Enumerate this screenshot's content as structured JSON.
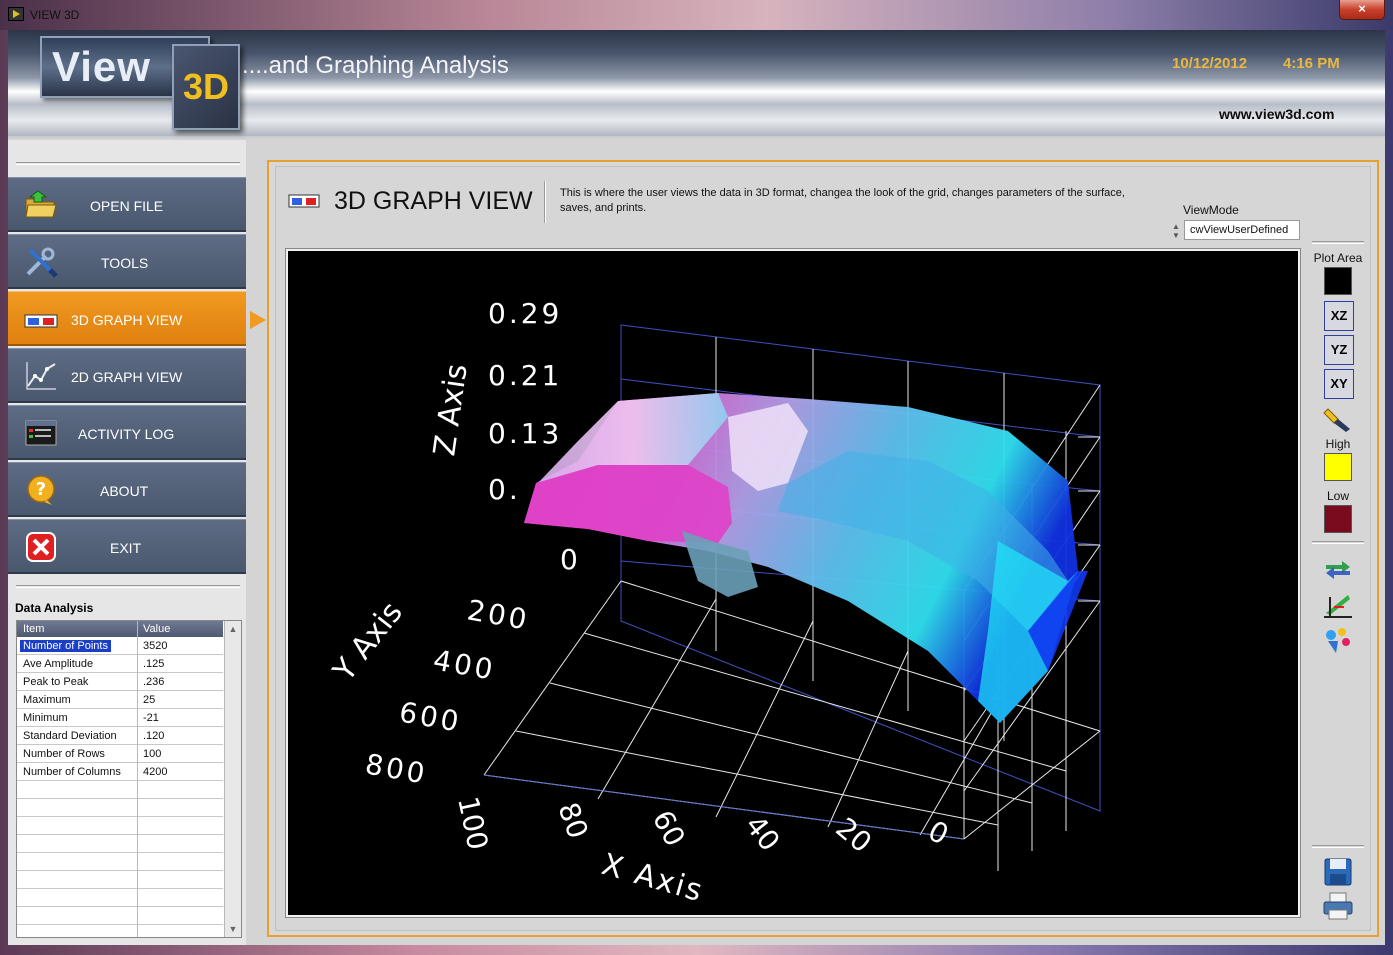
{
  "window": {
    "title": "VIEW 3D",
    "close_label": "×"
  },
  "header": {
    "logo_view": "View",
    "logo_3d": "3D",
    "tagline": "....and Graphing Analysis",
    "date": "10/12/2012",
    "time": "4:16 PM",
    "url": "www.view3d.com"
  },
  "sidebar": {
    "items": [
      {
        "label": "OPEN FILE",
        "icon": "folder-icon"
      },
      {
        "label": "TOOLS",
        "icon": "wrench-screwdriver-icon"
      },
      {
        "label": "3D GRAPH VIEW",
        "icon": "3d-glasses-icon",
        "active": true
      },
      {
        "label": "2D GRAPH VIEW",
        "icon": "line-graph-icon"
      },
      {
        "label": "ACTIVITY LOG",
        "icon": "log-window-icon"
      },
      {
        "label": "ABOUT",
        "icon": "question-icon"
      },
      {
        "label": "EXIT",
        "icon": "exit-x-icon"
      }
    ],
    "active_color": "#f09a20"
  },
  "data_analysis": {
    "title": "Data Analysis",
    "columns": [
      "Item",
      "Value"
    ],
    "rows": [
      {
        "item": "Number of Points",
        "value": "3520"
      },
      {
        "item": "Ave Amplitude",
        "value": ".125"
      },
      {
        "item": "Peak to Peak",
        "value": ".236"
      },
      {
        "item": "Maximum",
        "value": "25"
      },
      {
        "item": "Minimum",
        "value": "-21"
      },
      {
        "item": "Standard Deviation",
        "value": ".120"
      },
      {
        "item": "Number of Rows",
        "value": "100"
      },
      {
        "item": "Number of Columns",
        "value": "4200"
      }
    ],
    "selected_row": 0
  },
  "main": {
    "title": "3D GRAPH VIEW",
    "description": "This is where the user views the data in 3D format, changea the look of the grid, changes parameters of the surface, saves, and prints.",
    "viewmode_label": "ViewMode",
    "viewmode_value": "cwViewUserDefined"
  },
  "plot_3d": {
    "z_axis_label": "Z Axis",
    "y_axis_label": "Y Axis",
    "x_axis_label": "X Axis",
    "z_ticks": [
      "0.29",
      "0.21",
      "0.13",
      "0.",
      "0"
    ],
    "y_ticks": [
      "200",
      "400",
      "600",
      "800"
    ],
    "x_ticks": [
      "100",
      "80",
      "60",
      "40",
      "20",
      "0"
    ],
    "background": "#000000",
    "surface_colors": [
      "#e040c0",
      "#c8a0e8",
      "#40e0f0",
      "#1030e0"
    ]
  },
  "side_tools": {
    "plot_area_label": "Plot Area",
    "plot_area_color": "#000000",
    "planes": [
      "XZ",
      "YZ",
      "XY"
    ],
    "high_label": "High",
    "high_color": "#ffff00",
    "low_label": "Low",
    "low_color": "#7a0a1e",
    "icons": [
      "flashlight-icon",
      "swap-arrows-icon",
      "axis-tool-icon",
      "color-dots-icon",
      "save-icon",
      "print-icon"
    ]
  }
}
